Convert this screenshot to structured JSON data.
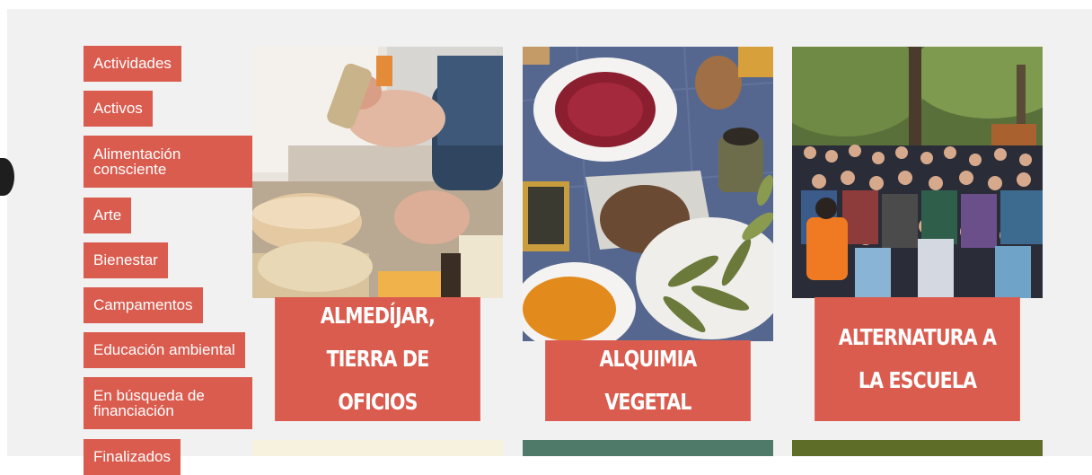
{
  "categories": [
    {
      "label": "Actividades"
    },
    {
      "label": "Activos"
    },
    {
      "label": "Alimentación consciente"
    },
    {
      "label": "Arte"
    },
    {
      "label": "Bienestar"
    },
    {
      "label": "Campamentos"
    },
    {
      "label": "Educación ambiental"
    },
    {
      "label": "En búsqueda de financiación"
    },
    {
      "label": "Finalizados"
    }
  ],
  "cards": [
    {
      "title": "ALMEDÍJAR, TIERRA DE OFICIOS",
      "image": "artisan-cheese-photo"
    },
    {
      "title": "ALQUIMIA VEGETAL",
      "image": "spices-herbs-photo"
    },
    {
      "title": "ALTERNATURA A LA ESCUELA",
      "image": "school-group-photo"
    }
  ],
  "colors": {
    "accent": "#da5c4f",
    "panel": "#f1f1f1"
  }
}
